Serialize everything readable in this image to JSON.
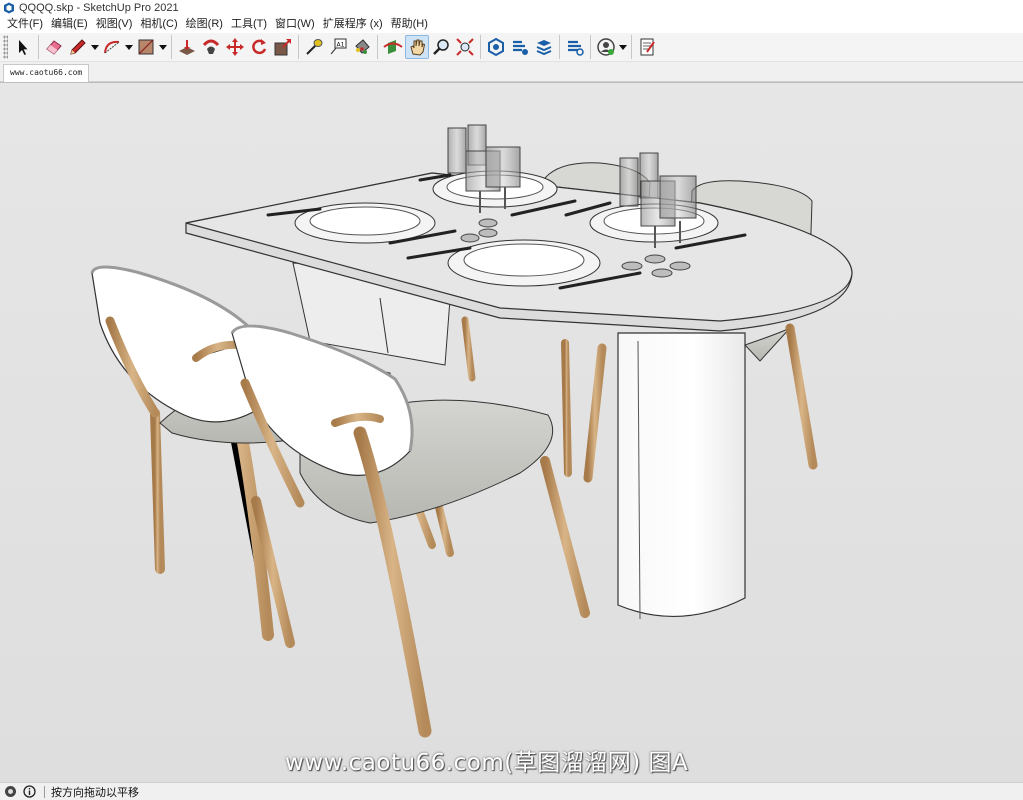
{
  "window": {
    "title": "QQQQ.skp - SketchUp Pro 2021"
  },
  "menu": {
    "items": [
      "文件(F)",
      "编辑(E)",
      "视图(V)",
      "相机(C)",
      "绘图(R)",
      "工具(T)",
      "窗口(W)",
      "扩展程序 (x)",
      "帮助(H)"
    ]
  },
  "toolbar": {
    "tools": [
      {
        "name": "select-tool",
        "icon": "cursor-arrow-icon",
        "active": false
      },
      {
        "name": "eraser-tool",
        "icon": "eraser-icon",
        "active": false
      },
      {
        "name": "pencil-tool",
        "icon": "pencil-icon",
        "active": false
      },
      {
        "name": "arc-tool",
        "icon": "arc-icon",
        "active": false
      },
      {
        "name": "rectangle-tool",
        "icon": "rectangle-shape-icon",
        "active": false
      },
      {
        "name": "push-pull-tool",
        "icon": "push-pull-icon",
        "active": false
      },
      {
        "name": "follow-me-tool",
        "icon": "follow-me-icon",
        "active": false
      },
      {
        "name": "move-tool",
        "icon": "move-arrows-icon",
        "active": false
      },
      {
        "name": "rotate-tool",
        "icon": "rotate-icon",
        "active": false
      },
      {
        "name": "scale-tool",
        "icon": "scale-icon",
        "active": false
      },
      {
        "name": "tape-measure-tool",
        "icon": "tape-measure-icon",
        "active": false
      },
      {
        "name": "text-tool",
        "icon": "text-label-icon",
        "active": false
      },
      {
        "name": "paint-bucket-tool",
        "icon": "paint-bucket-icon",
        "active": false
      },
      {
        "name": "orbit-tool",
        "icon": "orbit-icon",
        "active": false
      },
      {
        "name": "pan-tool",
        "icon": "hand-pan-icon",
        "active": true
      },
      {
        "name": "zoom-tool",
        "icon": "magnifier-icon",
        "active": false
      },
      {
        "name": "zoom-extents-tool",
        "icon": "zoom-extents-icon",
        "active": false
      },
      {
        "name": "warehouse-tool",
        "icon": "3d-warehouse-icon",
        "active": false
      },
      {
        "name": "extension-warehouse-tool",
        "icon": "extension-warehouse-icon",
        "active": false
      },
      {
        "name": "layout-tool",
        "icon": "layout-stack-icon",
        "active": false
      },
      {
        "name": "extension-manager-tool",
        "icon": "extension-manager-icon",
        "active": false
      },
      {
        "name": "user-account-tool",
        "icon": "user-account-icon",
        "active": false
      },
      {
        "name": "report-tool",
        "icon": "report-document-icon",
        "active": false
      }
    ]
  },
  "document_tab": {
    "label": "www.caotu66.com"
  },
  "viewport": {
    "watermark": "www.caotu66.com(草图溜溜网) 图A"
  },
  "status": {
    "text": "按方向拖动以平移"
  },
  "colors": {
    "viewport_bg": "#e2e2e2",
    "toolbar_bg": "#f4f4f4",
    "active_tool": "#cfe3f7",
    "wood": "#c8a273",
    "seat_fabric": "#c9c9c5"
  }
}
